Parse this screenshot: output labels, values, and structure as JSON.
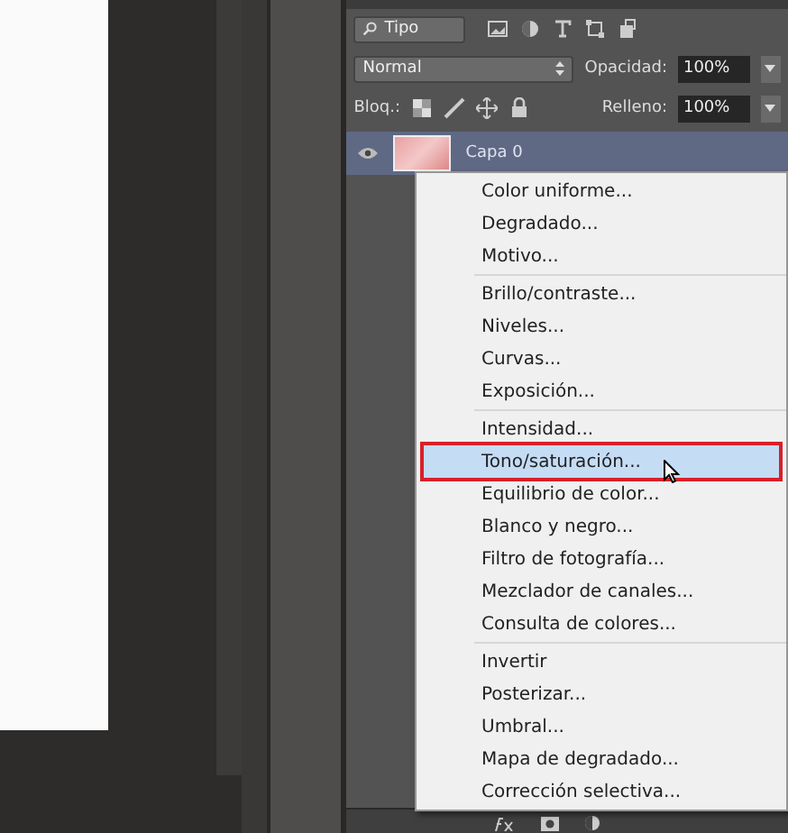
{
  "layers_panel": {
    "filter": {
      "value": "Tipo"
    },
    "blend_mode": {
      "value": "Normal"
    },
    "opacity": {
      "label": "Opacidad:",
      "value": "100%"
    },
    "lock": {
      "label": "Bloq.:"
    },
    "fill": {
      "label": "Relleno:",
      "value": "100%"
    },
    "layers": [
      {
        "name": "Capa 0",
        "visible": true,
        "selected": true
      }
    ]
  },
  "adjustment_menu": {
    "sections": [
      [
        {
          "label": "Color uniforme...",
          "selected": false,
          "marked": false
        },
        {
          "label": "Degradado...",
          "selected": false,
          "marked": false
        },
        {
          "label": "Motivo...",
          "selected": false,
          "marked": false
        }
      ],
      [
        {
          "label": "Brillo/contraste...",
          "selected": false,
          "marked": false
        },
        {
          "label": "Niveles...",
          "selected": false,
          "marked": false
        },
        {
          "label": "Curvas...",
          "selected": false,
          "marked": false
        },
        {
          "label": "Exposición...",
          "selected": false,
          "marked": false
        }
      ],
      [
        {
          "label": "Intensidad...",
          "selected": false,
          "marked": false
        },
        {
          "label": "Tono/saturación...",
          "selected": true,
          "marked": true
        },
        {
          "label": "Equilibrio de color...",
          "selected": false,
          "marked": false
        },
        {
          "label": "Blanco y negro...",
          "selected": false,
          "marked": false
        },
        {
          "label": "Filtro de fotografía...",
          "selected": false,
          "marked": false
        },
        {
          "label": "Mezclador de canales...",
          "selected": false,
          "marked": false
        },
        {
          "label": "Consulta de colores...",
          "selected": false,
          "marked": false
        }
      ],
      [
        {
          "label": "Invertir",
          "selected": false,
          "marked": false
        },
        {
          "label": "Posterizar...",
          "selected": false,
          "marked": false
        },
        {
          "label": "Umbral...",
          "selected": false,
          "marked": false
        },
        {
          "label": "Mapa de degradado...",
          "selected": false,
          "marked": false
        },
        {
          "label": "Corrección selectiva...",
          "selected": false,
          "marked": false
        }
      ]
    ]
  }
}
